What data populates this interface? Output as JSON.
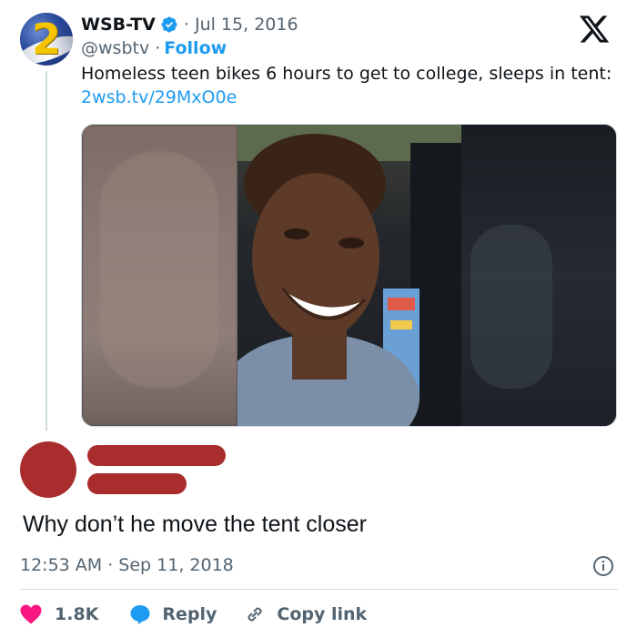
{
  "quoted_tweet": {
    "avatar_digit": "2",
    "display_name": "WSB-TV",
    "separator_date": "· Jul 15, 2016",
    "handle": "@wsbtv ·",
    "follow_label": "Follow",
    "text": "Homeless teen bikes 6 hours to get to college, sleeps in tent:",
    "link": "2wsb.tv/29MxO0e",
    "icons": [
      "verified-badge-icon",
      "x-logo-icon"
    ]
  },
  "reply": {
    "text": "Why don’t he move the tent closer",
    "timestamp": "12:53 AM · Sep 11, 2018",
    "redaction_color": "#a92d2d"
  },
  "actions": {
    "like_count": "1.8K",
    "reply_label": "Reply",
    "copy_label": "Copy link",
    "icons": [
      "heart-icon",
      "speech-bubble-icon",
      "link-icon",
      "info-icon"
    ]
  },
  "colors": {
    "accent": "#1d9bf0",
    "like": "#f91880",
    "text_primary": "#0f1419",
    "text_secondary": "#536471"
  }
}
